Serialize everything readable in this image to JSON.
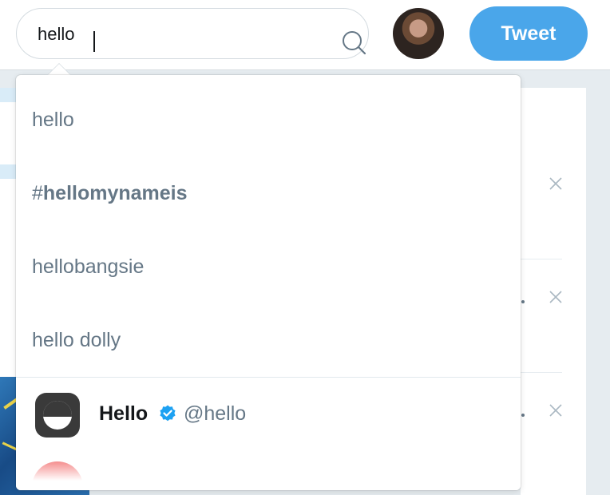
{
  "search": {
    "value": "hello",
    "icon": "search-icon"
  },
  "header": {
    "tweet_label": "Tweet",
    "avatar_icon": "user-avatar"
  },
  "dropdown": {
    "suggestions": [
      {
        "text": "hello"
      },
      {
        "hash": "#",
        "text": "hellomynameis"
      },
      {
        "text": "hellobangsie"
      },
      {
        "text": "hello dolly"
      }
    ],
    "users": [
      {
        "name": "Hello",
        "handle": "@hello",
        "verified": true
      }
    ]
  },
  "colors": {
    "accent": "#4aa6ea",
    "text_secondary": "#657786",
    "text_primary": "#14171a"
  }
}
